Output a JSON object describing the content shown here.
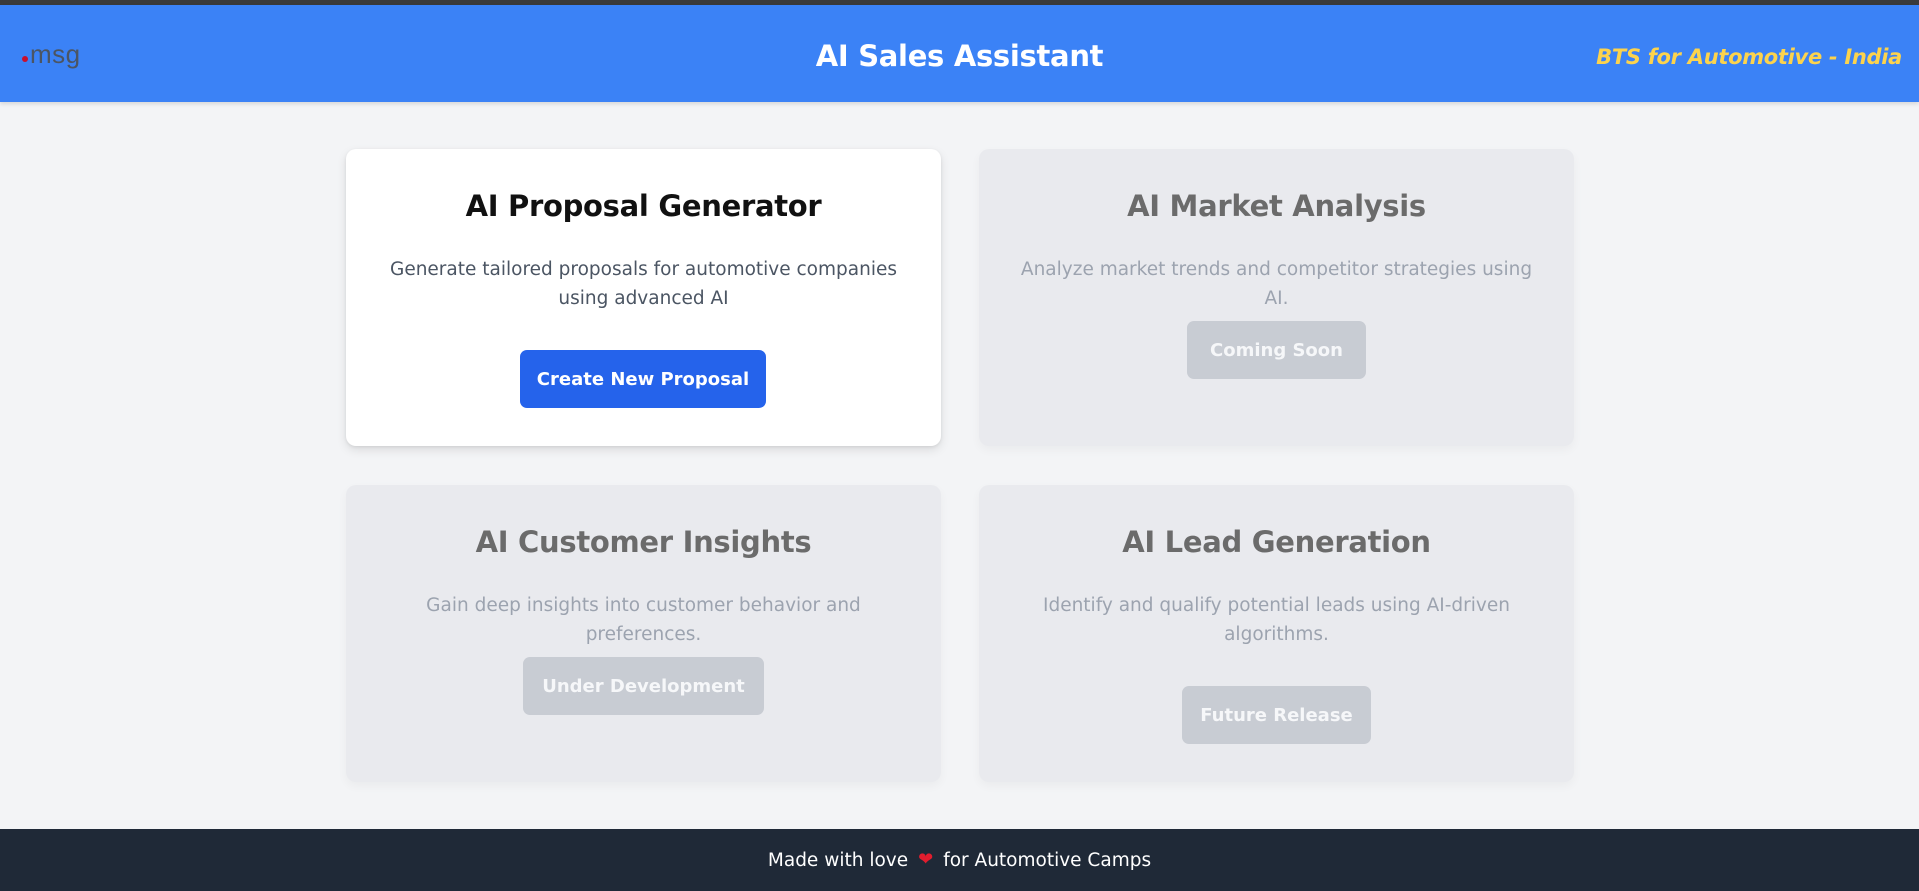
{
  "header": {
    "logo_text": "msg",
    "title": "AI Sales Assistant",
    "subtitle": "BTS for Automotive - India"
  },
  "cards": [
    {
      "title": "AI Proposal Generator",
      "description": "Generate tailored proposals for automotive companies using advanced AI",
      "button": "Create New Proposal",
      "status": "active"
    },
    {
      "title": "AI Market Analysis",
      "description": "Analyze market trends and competitor strategies using AI.",
      "button": "Coming Soon",
      "status": "disabled"
    },
    {
      "title": "AI Customer Insights",
      "description": "Gain deep insights into customer behavior and preferences.",
      "button": "Under Development",
      "status": "disabled"
    },
    {
      "title": "AI Lead Generation",
      "description": "Identify and qualify potential leads using AI-driven algorithms.",
      "button": "Future Release",
      "status": "disabled"
    }
  ],
  "footer": {
    "text_before": "Made with love",
    "heart_icon": "heart-icon",
    "text_after": "for Automotive Camps"
  },
  "colors": {
    "header_bg": "#3b82f6",
    "subtitle": "#fcd34d",
    "primary_button": "#2563eb",
    "disabled_button": "#c8ccd3",
    "footer_bg": "#1f2937",
    "heart": "#e11d2e",
    "logo_dot": "#c8102e"
  }
}
